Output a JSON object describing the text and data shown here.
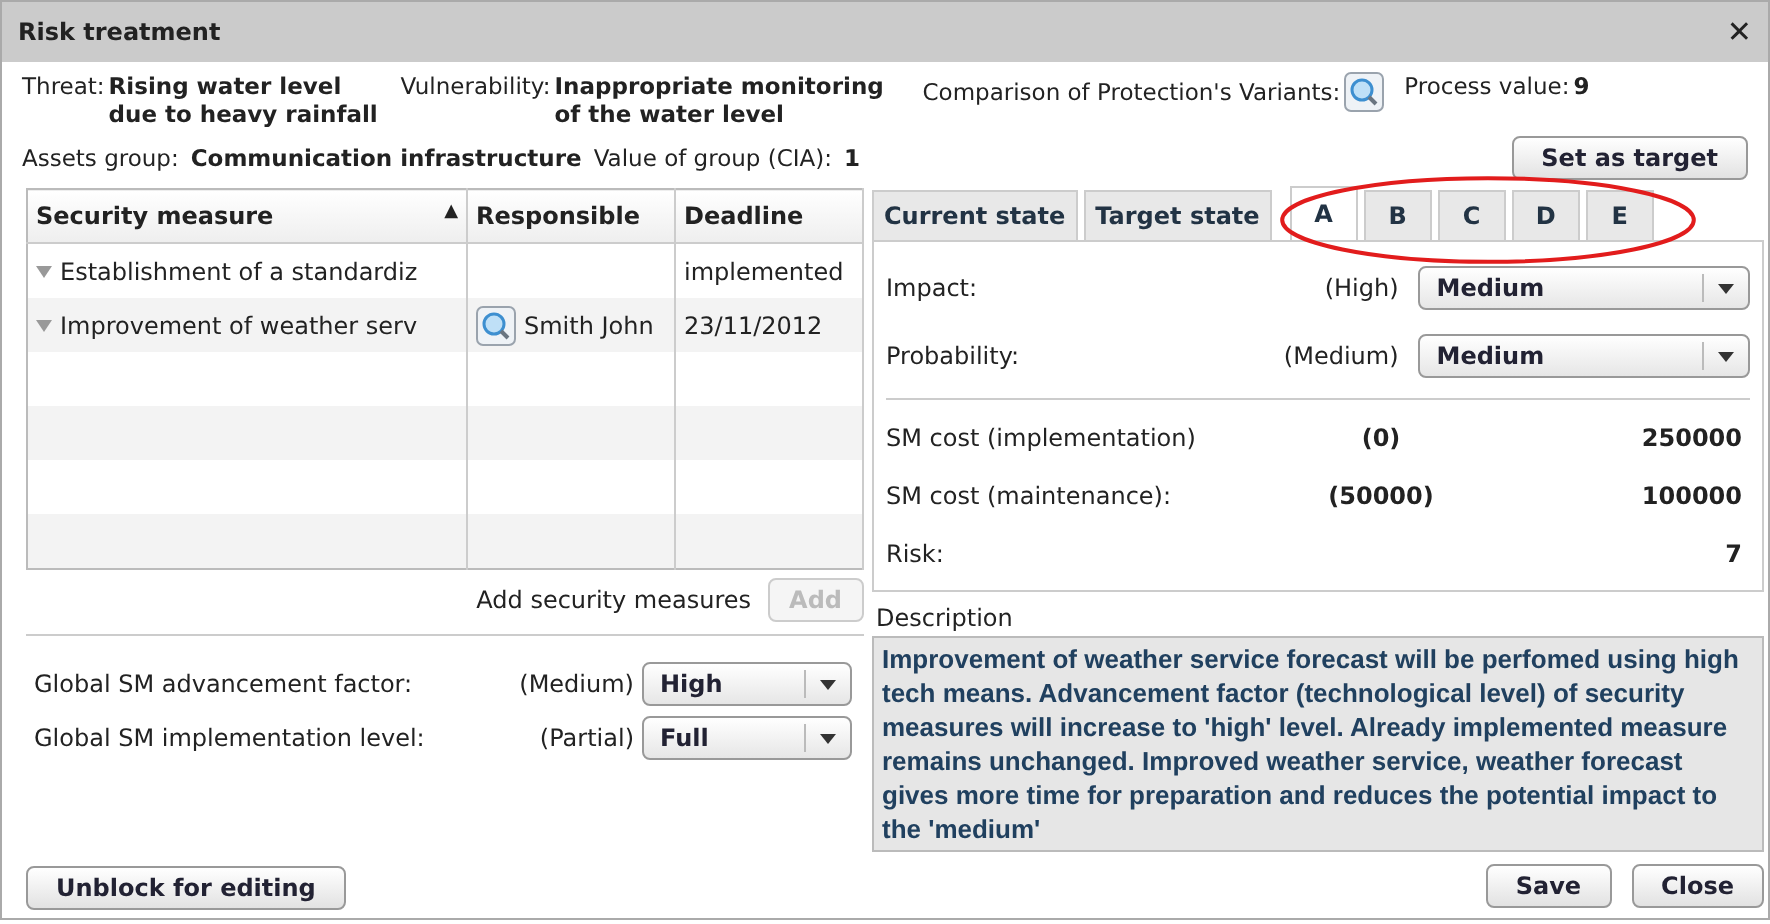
{
  "window": {
    "title": "Risk treatment",
    "close": "✕"
  },
  "header": {
    "threat_label": "Threat:",
    "threat": "Rising water level due to heavy rainfall",
    "vulnerability_label": "Vulnerability:",
    "vulnerability": "Inappropriate monitoring of the water level",
    "comparison_label": "Comparison of Protection's Variants:",
    "process_label": "Process value:",
    "process_value": "9",
    "assets_label": "Assets group:",
    "assets": "Communication infrastructure",
    "value_label": "Value of group (CIA):",
    "value": "1",
    "set_target_button": "Set as target"
  },
  "table": {
    "columns": [
      "Security measure",
      "Responsible",
      "Deadline"
    ],
    "sort_mark": "▲",
    "rows": [
      {
        "measure": "Establishment of a standardiz",
        "responsible": "",
        "deadline": "implemented",
        "lookup": false
      },
      {
        "measure": "Improvement of weather serv",
        "responsible": "Smith John",
        "deadline": "23/11/2012",
        "lookup": true
      }
    ]
  },
  "add": {
    "label": "Add security measures",
    "button": "Add",
    "disabled": true
  },
  "globals": [
    {
      "label": "Global SM advancement factor:",
      "current": "(Medium)",
      "value": "High"
    },
    {
      "label": "Global SM implementation level:",
      "current": "(Partial)",
      "value": "Full"
    }
  ],
  "unblock_button": "Unblock for editing",
  "tabs": [
    {
      "label": "Current state",
      "kind": "state",
      "selected": false
    },
    {
      "label": "Target state",
      "kind": "state",
      "selected": false
    },
    {
      "label": "A",
      "kind": "variant",
      "selected": true
    },
    {
      "label": "B",
      "kind": "variant",
      "selected": false
    },
    {
      "label": "C",
      "kind": "variant",
      "selected": false
    },
    {
      "label": "D",
      "kind": "variant",
      "selected": false
    },
    {
      "label": "E",
      "kind": "variant",
      "selected": false
    }
  ],
  "assessment": [
    {
      "label": "Impact:",
      "current": "(High)",
      "value": "Medium"
    },
    {
      "label": "Probability:",
      "current": "(Medium)",
      "value": "Medium"
    }
  ],
  "costs": [
    {
      "label": "SM cost (implementation)",
      "current": "(0)",
      "value": "250000"
    },
    {
      "label": "SM cost (maintenance):",
      "current": "(50000)",
      "value": "100000"
    },
    {
      "label": "Risk:",
      "value": "7"
    }
  ],
  "description": {
    "label": "Description",
    "text": "Improvement of weather service forecast will be perfomed using high tech means. Advancement factor (technological level) of security measures will increase to 'high' level. Already implemented measure remains unchanged. Improved weather service, weather forecast gives more time for preparation and reduces the potential impact to the 'medium'"
  },
  "buttons": [
    "Save",
    "Close"
  ]
}
